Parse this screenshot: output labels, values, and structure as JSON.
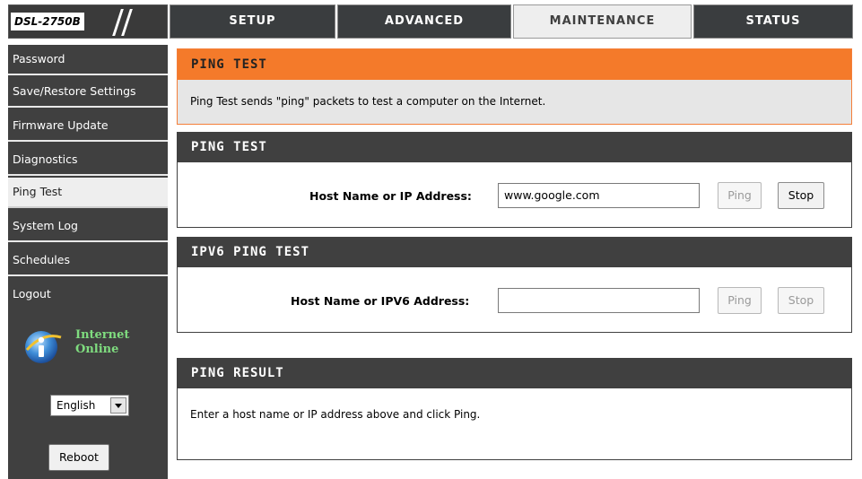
{
  "header": {
    "model": "DSL-2750B",
    "tabs": [
      {
        "label": "SETUP",
        "active": false
      },
      {
        "label": "ADVANCED",
        "active": false
      },
      {
        "label": "MAINTENANCE",
        "active": true
      },
      {
        "label": "STATUS",
        "active": false
      }
    ]
  },
  "sidebar": {
    "items": [
      {
        "label": "Password",
        "active": false
      },
      {
        "label": "Save/Restore Settings",
        "active": false
      },
      {
        "label": "Firmware Update",
        "active": false
      },
      {
        "label": "Diagnostics",
        "active": false
      },
      {
        "label": "Ping Test",
        "active": true
      },
      {
        "label": "System Log",
        "active": false
      },
      {
        "label": "Schedules",
        "active": false
      },
      {
        "label": "Logout",
        "active": false
      }
    ],
    "status_line1": "Internet",
    "status_line2": "Online",
    "language": "English",
    "reboot_label": "Reboot"
  },
  "intro": {
    "title": "PING TEST",
    "description": "Ping Test sends \"ping\" packets to test a computer on the Internet."
  },
  "ping_ipv4": {
    "title": "PING TEST",
    "label": "Host Name or IP Address:",
    "value": "www.google.com",
    "ping_label": "Ping",
    "stop_label": "Stop",
    "ping_enabled": false,
    "stop_enabled": true
  },
  "ping_ipv6": {
    "title": "IPV6 PING TEST",
    "label": "Host Name or IPV6 Address:",
    "value": "",
    "ping_label": "Ping",
    "stop_label": "Stop",
    "ping_enabled": false,
    "stop_enabled": false
  },
  "result": {
    "title": "PING RESULT",
    "message": "Enter a host name or IP address above and click Ping."
  },
  "colors": {
    "accent_orange": "#f47a2a",
    "dark_gray": "#404040",
    "status_green": "#7fdc7f"
  }
}
